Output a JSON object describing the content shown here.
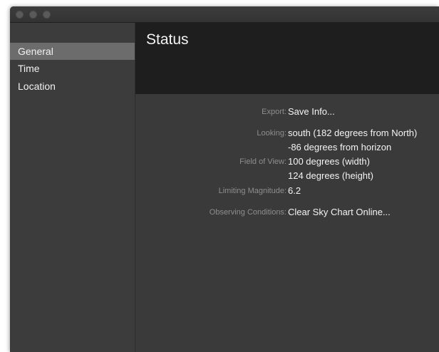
{
  "sidebar": {
    "items": [
      {
        "label": "General",
        "selected": true
      },
      {
        "label": "Time",
        "selected": false
      },
      {
        "label": "Location",
        "selected": false
      }
    ]
  },
  "header": {
    "title": "Status"
  },
  "fields": {
    "export": {
      "label": "Export:",
      "value": "Save Info..."
    },
    "looking": {
      "label": "Looking:",
      "values": [
        "south (182 degrees from North)",
        "-86 degrees from horizon"
      ]
    },
    "field_of_view": {
      "label": "Field of View:",
      "values": [
        "100 degrees (width)",
        "124 degrees (height)"
      ]
    },
    "limiting_magnitude": {
      "label": "Limiting Magnitude:",
      "value": "6.2"
    },
    "observing_conditions": {
      "label": "Observing Conditions:",
      "value": "Clear Sky Chart Online..."
    }
  },
  "colors": {
    "header_bg": "#1e1e1e",
    "content_bg": "#3a3a3a",
    "sidebar_selected": "#6c6c6c",
    "label_text": "#8e8e8e",
    "value_text": "#f4f4f4"
  }
}
